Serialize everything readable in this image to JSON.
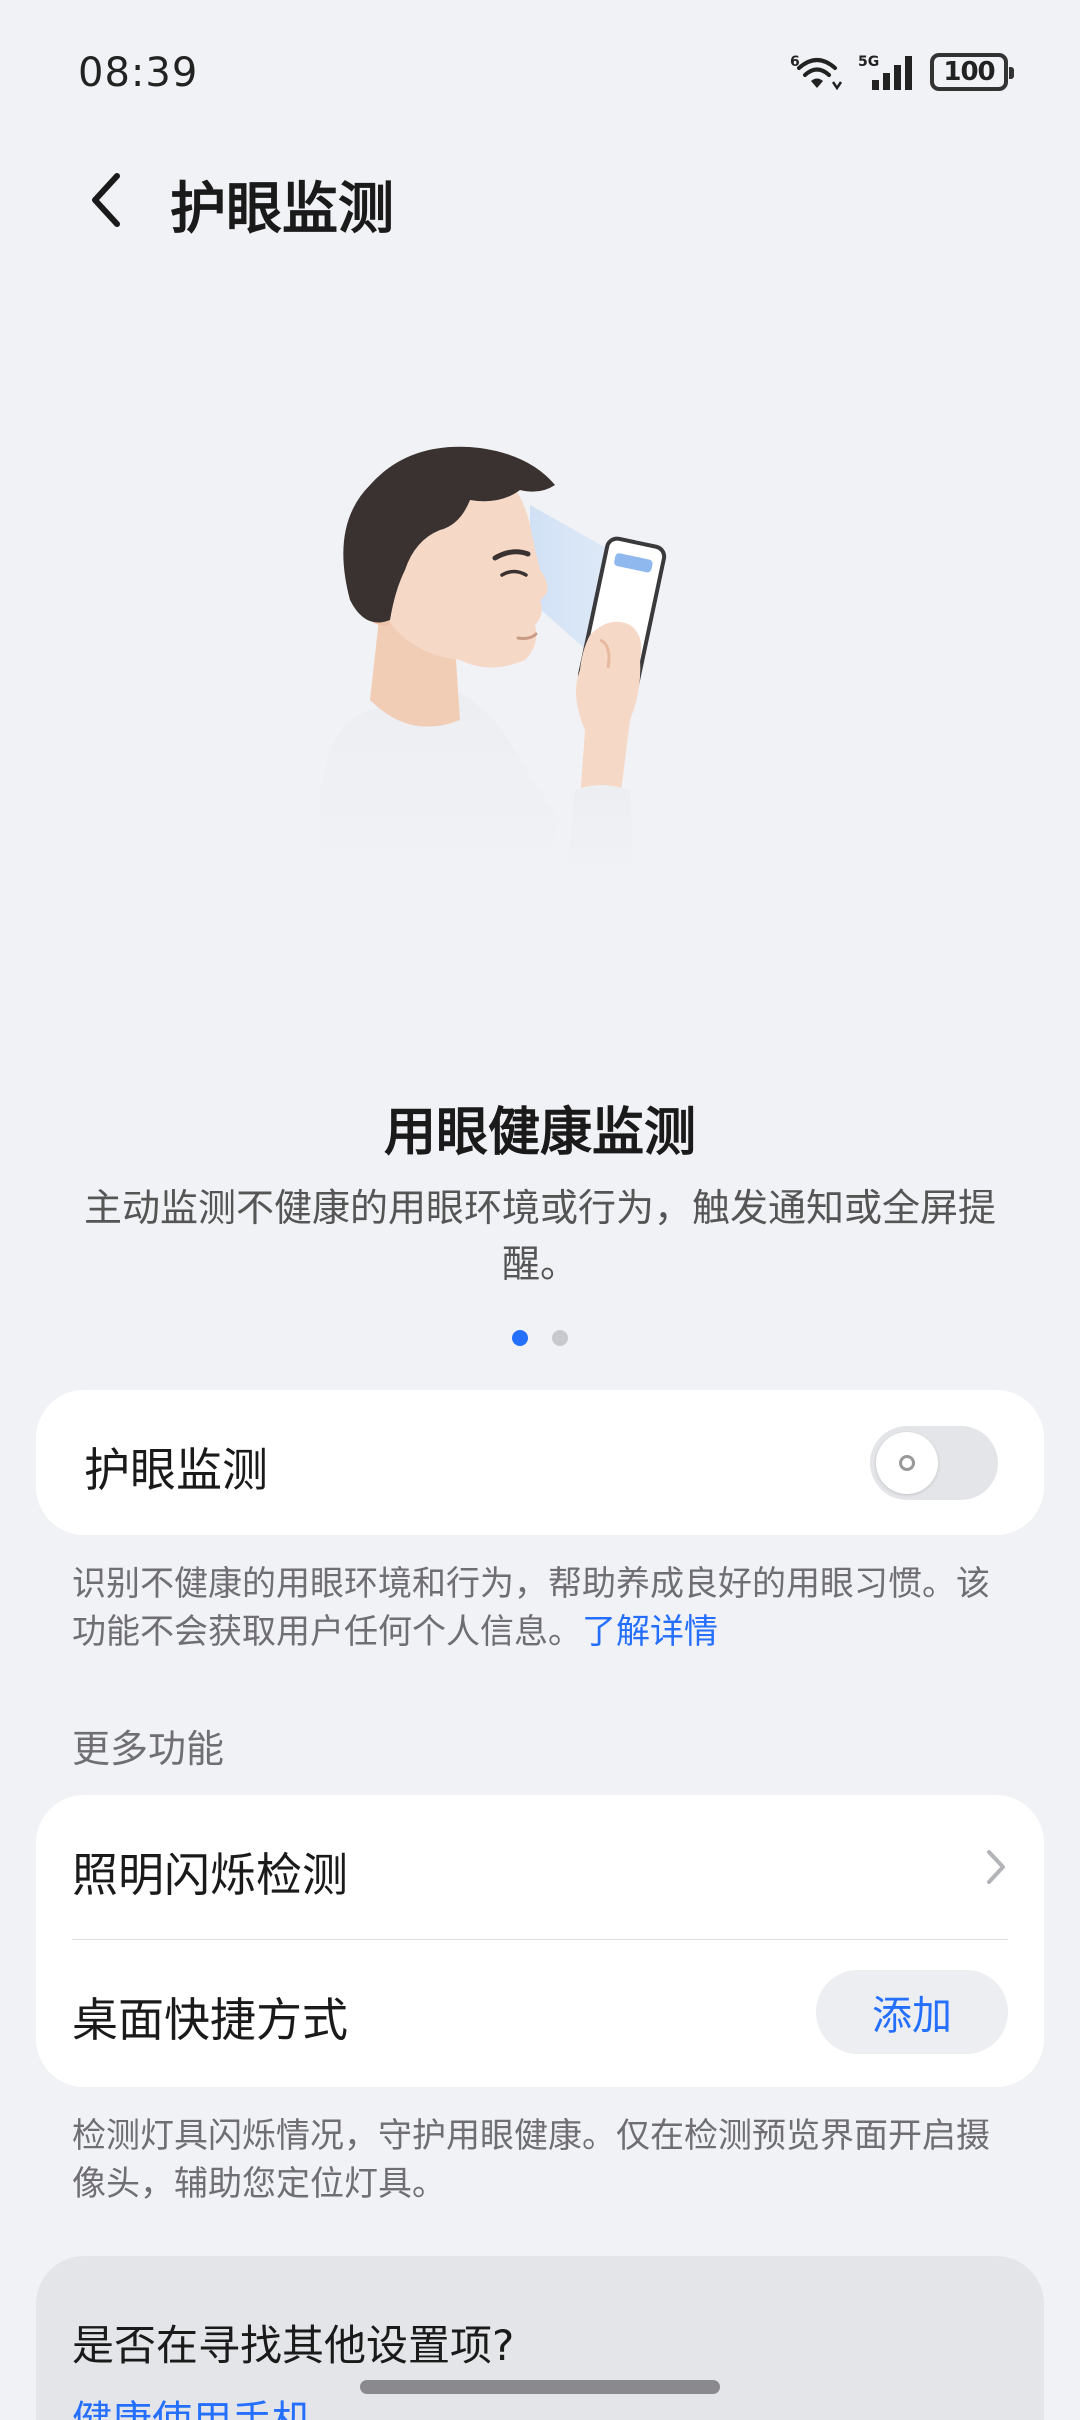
{
  "status_bar": {
    "time": "08:39",
    "battery": "100",
    "wifi_badge": "6",
    "network_type": "5G"
  },
  "header": {
    "title": "护眼监测"
  },
  "carousel": {
    "title": "用眼健康监测",
    "description": "主动监测不健康的用眼环境或行为，触发通知或全屏提醒。",
    "page_count": 2,
    "current_page": 1
  },
  "toggle_card": {
    "label": "护眼监测",
    "enabled": false
  },
  "toggle_helper": {
    "text": "识别不健康的用眼环境和行为，帮助养成良好的用眼习惯。该功能不会获取用户任何个人信息。",
    "link": "了解详情"
  },
  "more_features": {
    "header": "更多功能",
    "items": [
      {
        "label": "照明闪烁检测"
      },
      {
        "label": "桌面快捷方式",
        "action": "添加"
      }
    ],
    "helper": "检测灯具闪烁情况，守护用眼健康。仅在检测预览界面开启摄像头，辅助您定位灯具。"
  },
  "suggestion": {
    "title": "是否在寻找其他设置项?",
    "link": "健康使用手机"
  },
  "colors": {
    "accent": "#256fff",
    "background": "#f1f2f6",
    "card": "#ffffff"
  }
}
